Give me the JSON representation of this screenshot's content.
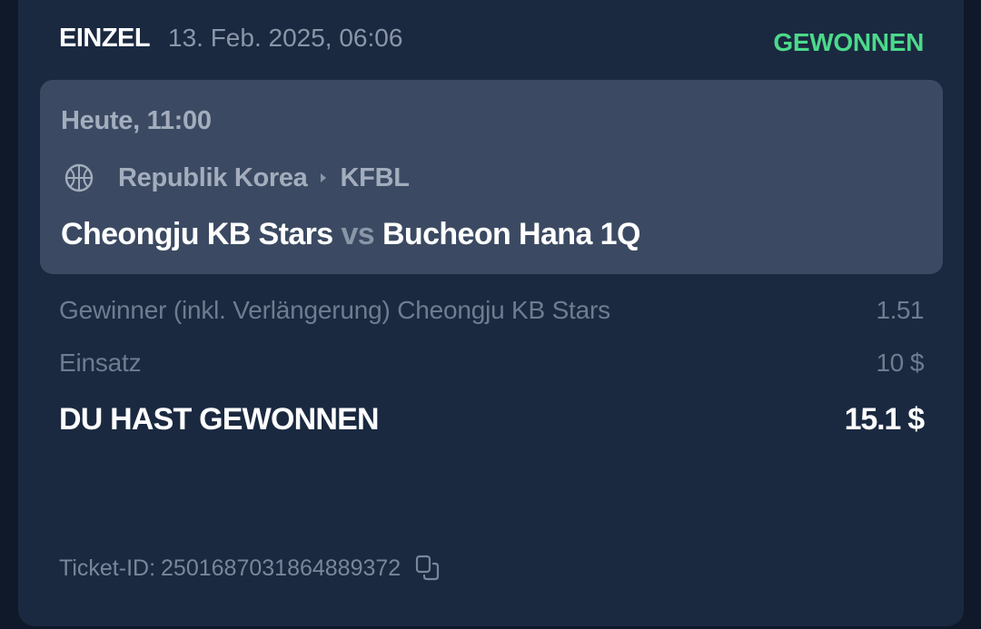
{
  "header": {
    "bet_type": "EINZEL",
    "date": "13. Feb. 2025, 06:06",
    "status": "GEWONNEN"
  },
  "event": {
    "time": "Heute, 11:00",
    "sport_icon": "basketball-icon",
    "country": "Republik Korea",
    "separator_icon": "caret-right-icon",
    "league": "KFBL",
    "home_team": "Cheongju KB Stars",
    "vs": "vs",
    "away_team": "Bucheon Hana 1Q"
  },
  "selection": {
    "market": "Gewinner (inkl. Verlängerung) Cheongju KB Stars",
    "odds": "1.51"
  },
  "stake": {
    "label": "Einsatz",
    "value": "10 $"
  },
  "winnings": {
    "label": "DU HAST GEWONNEN",
    "value": "15.1 $"
  },
  "ticket": {
    "label": "Ticket-ID:",
    "id": "2501687031864889372",
    "copy_icon": "copy-icon"
  },
  "colors": {
    "background": "#0f1929",
    "card": "#1a2940",
    "event_box": "#3b4a62",
    "status_won": "#4cd98a",
    "muted_text": "#6f7c90"
  }
}
